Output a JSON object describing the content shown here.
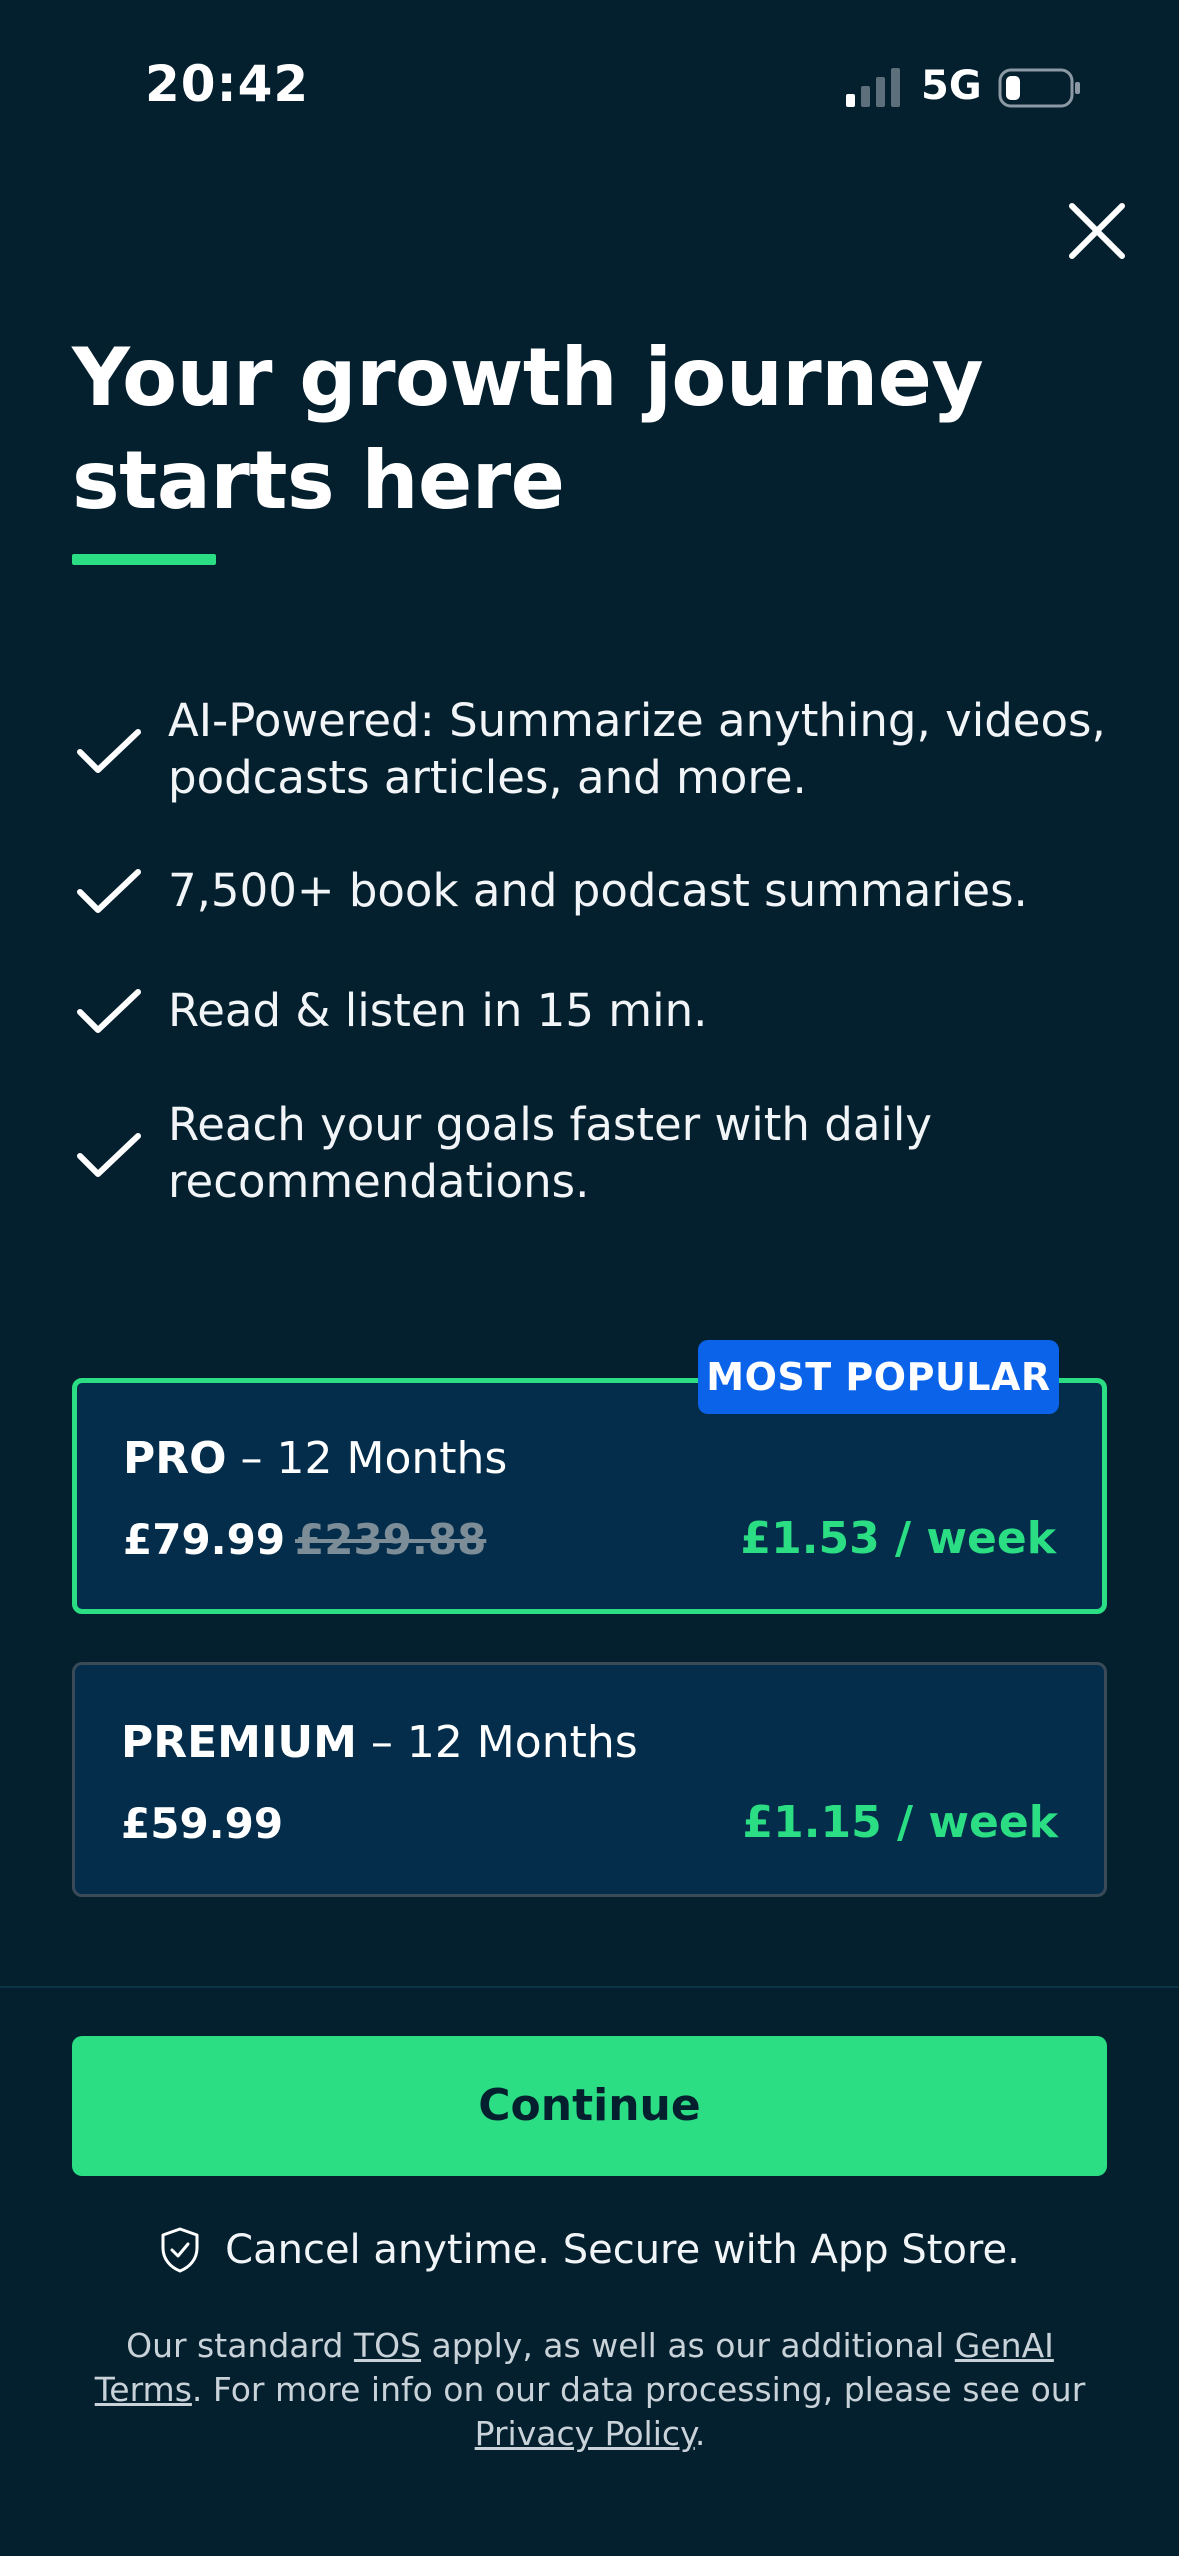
{
  "status_bar": {
    "time": "20:42",
    "network": "5G",
    "signal_icon": "signal-bars-icon",
    "battery_icon": "battery-low-icon"
  },
  "close_icon": "close-icon",
  "headline": {
    "line1": "Your growth journey",
    "line2": "starts here",
    "accent_color": "#2bde83"
  },
  "features": [
    {
      "icon": "check-icon",
      "text_line1": "AI-Powered: Summarize anything, videos,",
      "text_line2": "podcasts articles, and more."
    },
    {
      "icon": "check-icon",
      "text_line1": "7,500+ book and podcast summaries."
    },
    {
      "icon": "check-icon",
      "text_line1": "Read & listen in 15 min."
    },
    {
      "icon": "check-icon",
      "text_line1": "Reach your goals faster with daily",
      "text_line2": "recommendations."
    }
  ],
  "plans": {
    "badge": "MOST POPULAR",
    "pro": {
      "name": "PRO",
      "duration": " – 12 Months",
      "price": "£79.99",
      "old_price": "£239.88",
      "weekly": "£1.53 / week",
      "selected": true
    },
    "premium": {
      "name": "PREMIUM",
      "duration": " – 12 Months",
      "price": "£59.99",
      "weekly": "£1.15 / week",
      "selected": false
    }
  },
  "cta": {
    "continue_label": "Continue",
    "secure_text": "Cancel anytime. Secure with App Store.",
    "secure_icon": "shield-check-icon"
  },
  "legal": {
    "part1": "Our standard ",
    "tos_link": "TOS",
    "part2": " apply, as well as our additional ",
    "genai_link": "GenAI Terms",
    "part3": ". For more info on our data processing, please see our ",
    "privacy_link": "Privacy Policy",
    "part4": "."
  },
  "colors": {
    "background": "#04202e",
    "card": "#032d4b",
    "accent_green": "#2bde83",
    "badge_blue": "#0a63e9"
  }
}
